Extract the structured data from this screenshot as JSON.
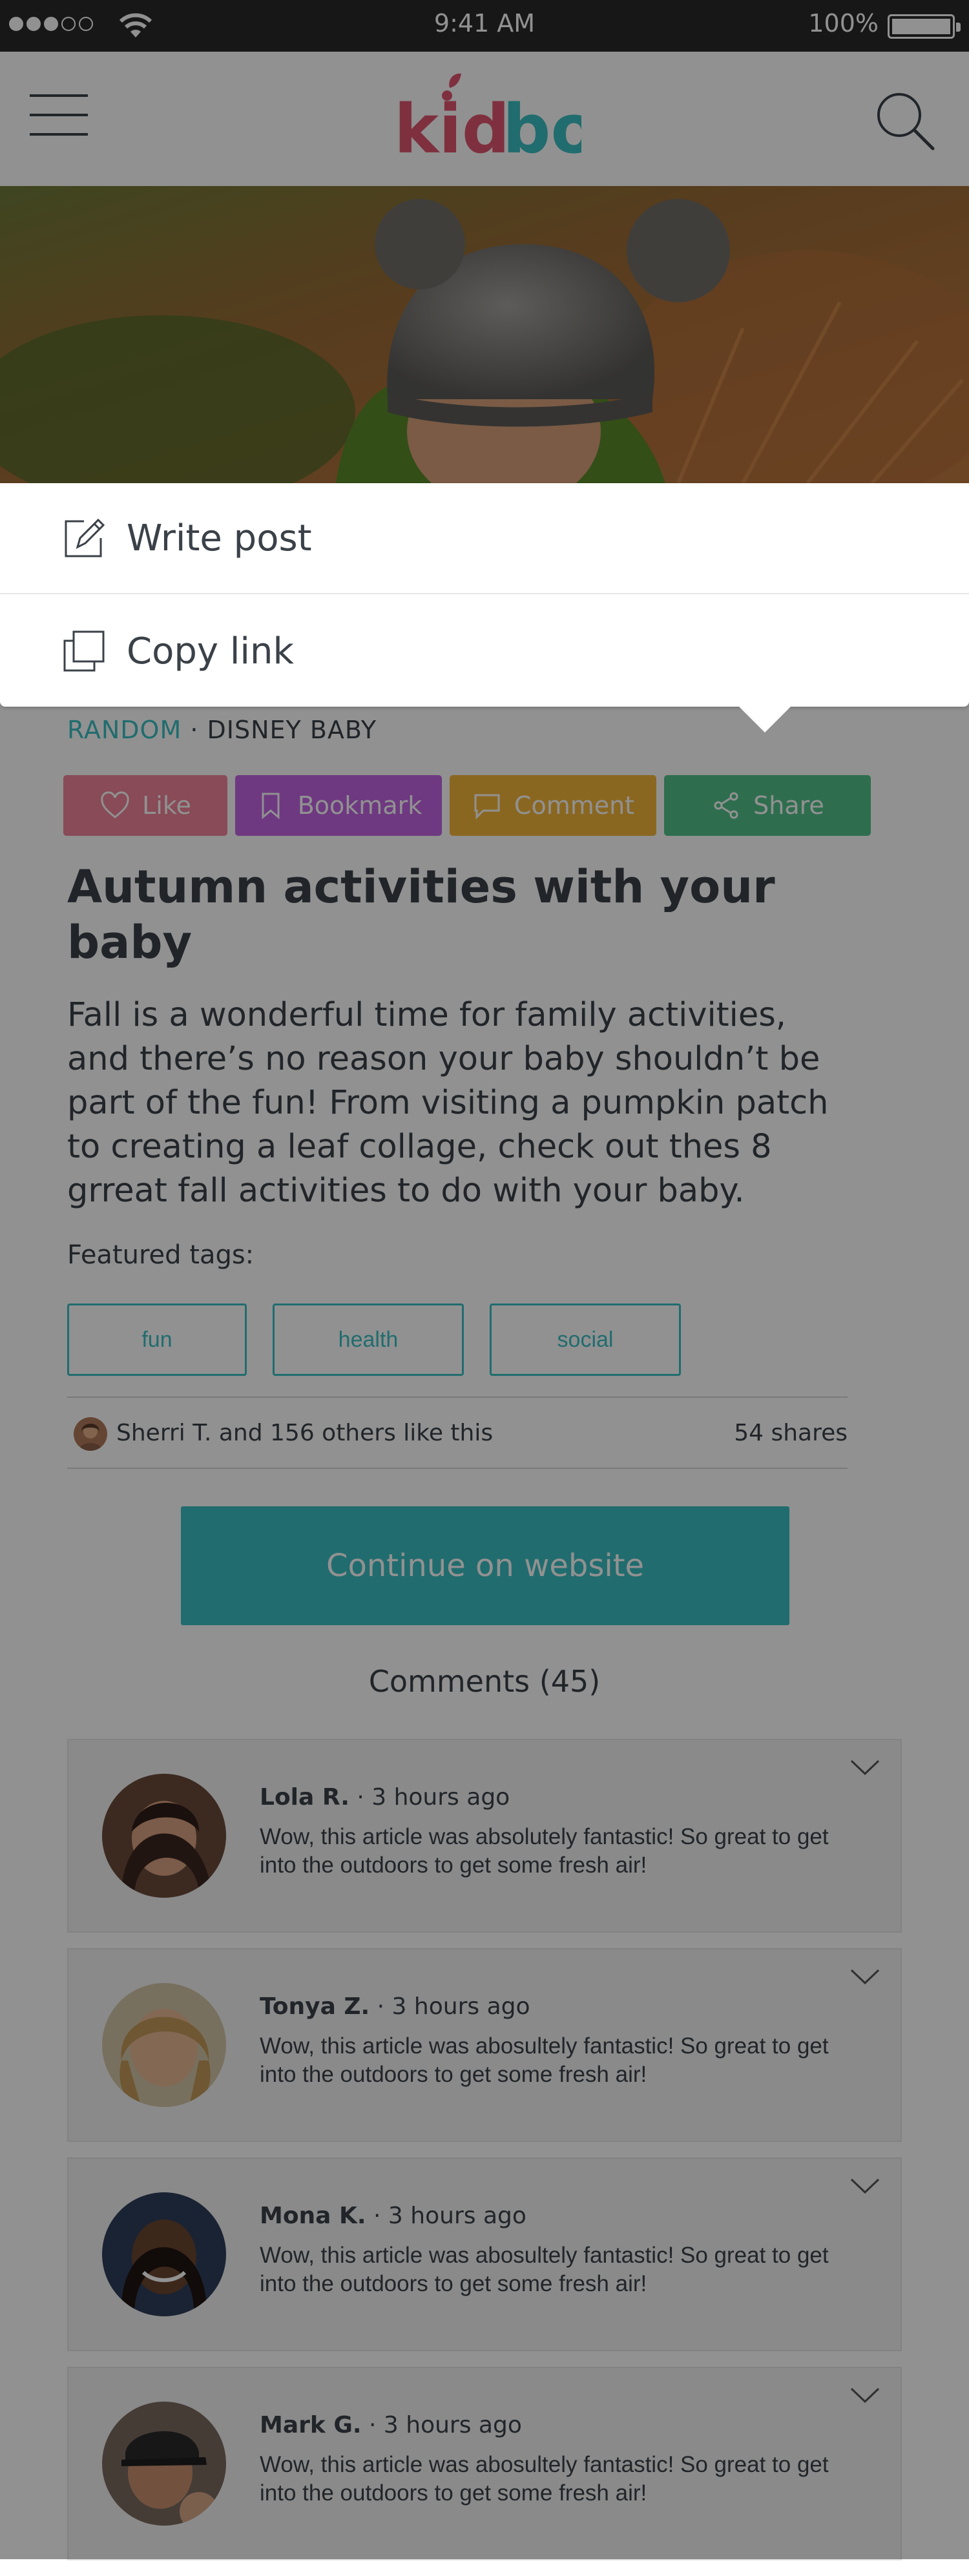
{
  "status_bar": {
    "time": "9:41 AM",
    "battery": "100%",
    "signal_dots_filled": 3,
    "signal_dots_total": 5
  },
  "header": {
    "logo_text": "kidbo",
    "menu_icon": "hamburger-menu-icon",
    "search_icon": "search-icon"
  },
  "popup_menu": {
    "items": [
      {
        "label": "Write post",
        "icon": "pencil-square-icon"
      },
      {
        "label": "Copy link",
        "icon": "copy-icon"
      }
    ]
  },
  "article": {
    "category_primary": "RANDOM",
    "separator": "·",
    "category_secondary": "DISNEY BABY",
    "actions": {
      "like": "Like",
      "bookmark": "Bookmark",
      "comment": "Comment",
      "share": "Share"
    },
    "title": "Autumn activities with your baby",
    "body": "Fall is a wonderful time for family activities, and there’s no reason your baby shouldn’t be part of the fun! From visiting a pumpkin patch to creating a leaf collage, check out thes 8 grreat fall activities to do with your baby.",
    "tags_label": "Featured tags:",
    "tags": [
      "fun",
      "health",
      "social"
    ],
    "likes_text": "Sherri T. and 156 others like this",
    "shares_text": "54 shares",
    "cta": "Continue on website",
    "comments_title": "Comments (45)"
  },
  "comments": [
    {
      "name": "Lola R.",
      "time": "· 3 hours ago",
      "text": "Wow, this article was absolutely fantastic! So great to get into the outdoors to get some fresh air!"
    },
    {
      "name": "Tonya Z.",
      "time": "· 3 hours ago",
      "text": "Wow, this article was abosultely fantastic! So great to get into the outdoors to get some fresh air!"
    },
    {
      "name": "Mona K.",
      "time": "· 3 hours ago",
      "text": "Wow, this article was abosultely fantastic! So great to get into the outdoors to get some fresh air!"
    },
    {
      "name": "Mark G.",
      "time": "· 3 hours ago",
      "text": "Wow, this article was abosultely fantastic! So great to get into the outdoors to get some fresh air!"
    }
  ],
  "colors": {
    "accent": "#3bbfc2",
    "like": "#f0859a",
    "bookmark": "#c264e3",
    "comment": "#f2b53b",
    "share": "#52c28a",
    "logo_pink": "#e05570"
  }
}
